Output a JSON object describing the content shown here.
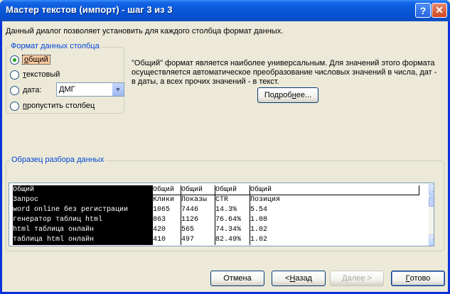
{
  "window": {
    "title": "Мастер текстов (импорт) - шаг 3 из 3",
    "help_label": "?",
    "close_label": "✕"
  },
  "intro": "Данный диалог позволяет установить для каждого столбца формат данных.",
  "format_group": {
    "legend": "Формат данных столбца",
    "options": [
      {
        "prefix": "",
        "accel": "о",
        "rest": "бщий",
        "checked": true
      },
      {
        "prefix": "",
        "accel": "т",
        "rest": "екстовый",
        "checked": false
      },
      {
        "prefix": "",
        "accel": "д",
        "rest": "ата:",
        "checked": false
      },
      {
        "prefix": "",
        "accel": "п",
        "rest": "ропустить столбец",
        "checked": false
      }
    ],
    "date_format": "ДМГ"
  },
  "description": [
    "\"Общий\" формат является наиболее универсальным. Для значений этого формата",
    "осуществляется автоматическое преобразование числовых значений в числа, дат -",
    "в даты, а всех прочих значений - в текст."
  ],
  "details_button": {
    "prefix": "Подроб",
    "accel": "н",
    "rest": "ее..."
  },
  "sample_group": {
    "legend": "Образец разбора данных",
    "headers": [
      "Общий",
      "Общий",
      "Общий",
      "Общий",
      "Общий"
    ],
    "rows": [
      [
        "Запрос",
        "Клики",
        "Показы",
        "CTR",
        "Позиция"
      ],
      [
        "word online без регистрации",
        "1065",
        "7446",
        "14.3%",
        "5.54"
      ],
      [
        "генератор таблиц html",
        "863",
        "1126",
        "76.64%",
        "1.08"
      ],
      [
        "html таблица онлайн",
        "420",
        "565",
        "74.34%",
        "1.02"
      ],
      [
        "таблица html онлайн",
        "410",
        "497",
        "82.49%",
        "1.02"
      ]
    ]
  },
  "buttons": {
    "cancel": "Отмена",
    "back_prefix": "< ",
    "back_accel": "Н",
    "back_rest": "азад",
    "next": "Далее >",
    "finish_accel": "Г",
    "finish_rest": "отово"
  },
  "icons": {
    "dropdown": "▼",
    "scroll_up": "▲",
    "scroll_down": "▼"
  }
}
